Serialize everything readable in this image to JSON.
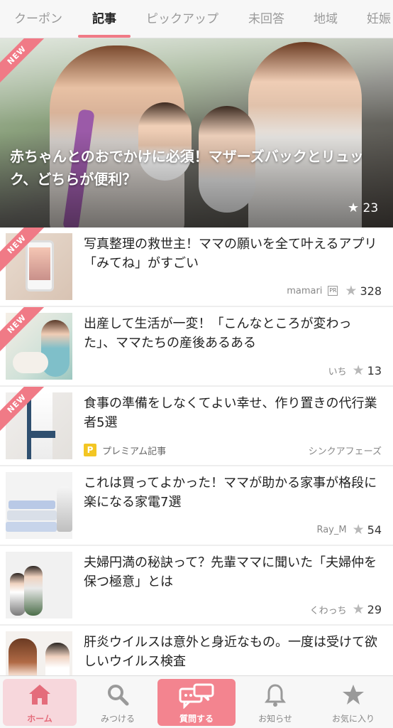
{
  "tabs": [
    {
      "label": "クーポン"
    },
    {
      "label": "記事"
    },
    {
      "label": "ピックアップ"
    },
    {
      "label": "未回答"
    },
    {
      "label": "地域"
    },
    {
      "label": "妊娠"
    }
  ],
  "active_tab": "記事",
  "hero": {
    "badge": "NEW",
    "title": "赤ちゃんとのおでかけに必須！マザーズバックとリュック、どちらが便利？",
    "star_count": "23"
  },
  "articles": [
    {
      "badge": "NEW",
      "title": "写真整理の救世主！ママの願いを全て叶えるアプリ「みてね」がすごい",
      "source": "mamari",
      "pr": "PR",
      "star_count": "328"
    },
    {
      "badge": "NEW",
      "title": "出産して生活が一変！「こんなところが変わった」、ママたちの産後あるある",
      "source": "いち",
      "star_count": "13"
    },
    {
      "badge": "NEW",
      "title": "食事の準備をしなくてよい幸せ、作り置きの代行業者5選",
      "premium_badge": "P",
      "premium_label": "プレミアム記事",
      "source": "シンクアフェーズ"
    },
    {
      "title": "これは買ってよかった！ママが助かる家事が格段に楽になる家電7選",
      "source": "Ray_M",
      "star_count": "54"
    },
    {
      "title": "夫婦円満の秘訣って？先輩ママに聞いた「夫婦仲を保つ極意」とは",
      "source": "くわっち",
      "star_count": "29"
    },
    {
      "title": "肝炎ウイルスは意外と身近なもの。一度は受けて欲しいウイルス検査"
    }
  ],
  "bottom_nav": [
    {
      "label": "ホーム",
      "icon": "home-icon"
    },
    {
      "label": "みつける",
      "icon": "search-icon"
    },
    {
      "label": "質問する",
      "icon": "chat-bubbles-icon"
    },
    {
      "label": "お知らせ",
      "icon": "bell-icon"
    },
    {
      "label": "お気に入り",
      "icon": "star-icon"
    }
  ],
  "colors": {
    "accent": "#f07a86",
    "accent_strong": "#f3848f",
    "home_bg": "#f7d7dc",
    "premium": "#f3c623"
  }
}
